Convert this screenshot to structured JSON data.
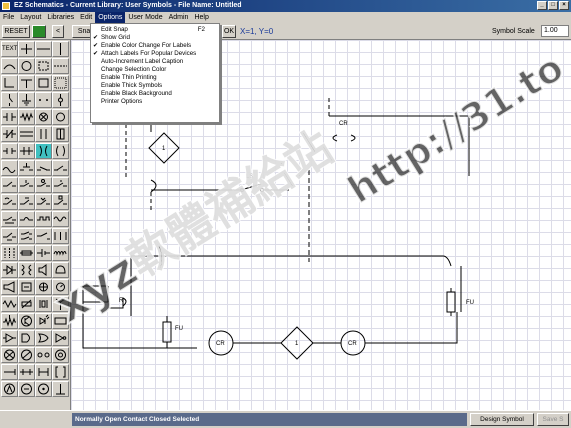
{
  "window": {
    "title": "EZ Schematics - Current Library: User Symbols - File Name: Untitled",
    "minimize": "_",
    "maximize": "□",
    "close": "×"
  },
  "menubar": {
    "items": [
      "File",
      "Layout",
      "Libraries",
      "Edit",
      "Options",
      "User Mode",
      "Admin",
      "Help"
    ],
    "active": "Options"
  },
  "toolbar": {
    "reset": "RESET",
    "back": "<",
    "snap": "Snap",
    "ok": "OK",
    "coordinates": "X=1, Y=0",
    "symbol_scale_label": "Symbol Scale",
    "symbol_scale_value": "1.00"
  },
  "options_menu": {
    "items": [
      {
        "label": "Edit Snap",
        "shortcut": "F2",
        "checked": false
      },
      {
        "label": "Show Grid",
        "shortcut": "",
        "checked": true
      },
      {
        "label": "Enable Color Change For Labels",
        "shortcut": "",
        "checked": true
      },
      {
        "label": "Attach Labels For Popular Devices",
        "shortcut": "",
        "checked": true
      },
      {
        "label": "Auto-Increment Label Caption",
        "shortcut": "",
        "checked": false
      },
      {
        "label": "Change Selection Color",
        "shortcut": "",
        "checked": false
      },
      {
        "label": "Enable Thin Printing",
        "shortcut": "",
        "checked": false
      },
      {
        "label": "Enable Thick Symbols",
        "shortcut": "",
        "checked": false
      },
      {
        "label": "Enable Black Background",
        "shortcut": "",
        "checked": false
      },
      {
        "label": "Printer Options",
        "shortcut": "",
        "checked": false
      }
    ],
    "check_glyph": "✔"
  },
  "palette": {
    "text_label": "TEXT"
  },
  "canvas": {
    "labels": {
      "ls": "LS",
      "cr_top": "CR",
      "fu_left": "FU",
      "fu_right": "FU",
      "r_left": "R",
      "cr_coil_1": "CR",
      "cr_coil_2": "CR",
      "diamond_top": "1",
      "diamond_mid": "1"
    }
  },
  "statusbar": {
    "message": "Normally Open Contact Closed Selected",
    "design_symbol": "Design Symbol",
    "save": "Save S"
  },
  "watermark": {
    "text1": "xyz軟體補給站",
    "text2": "http://31.to"
  },
  "colors": {
    "titlebar": "#0a246a",
    "selection": "#40c0c0",
    "status": "#5a6a8a"
  }
}
